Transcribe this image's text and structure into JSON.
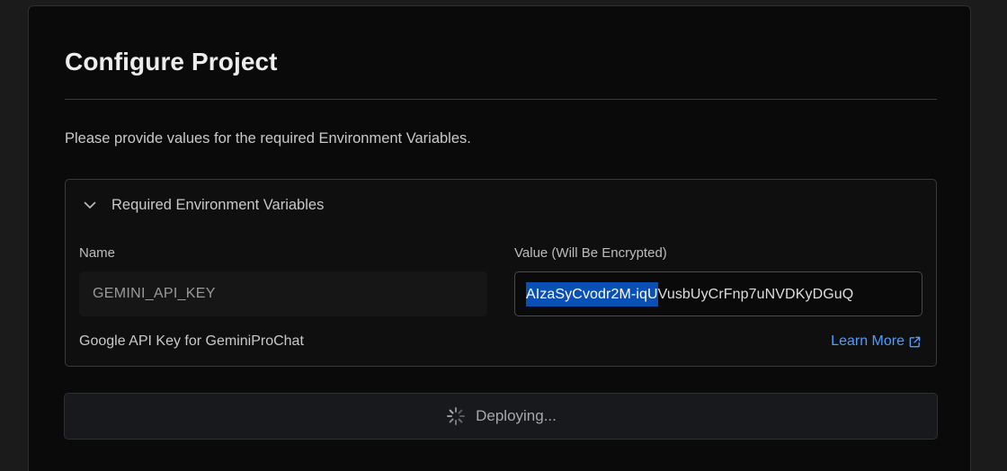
{
  "page": {
    "title": "Configure Project",
    "description": "Please provide values for the required Environment Variables."
  },
  "env_panel": {
    "header": "Required Environment Variables",
    "name_label": "Name",
    "value_label": "Value (Will Be Encrypted)",
    "name_value": "GEMINI_API_KEY",
    "value_selected": "AIzaSyCvodr2M-iqU",
    "value_rest": "VusbUyCrFnp7uNVDKyDGuQ",
    "help_text": "Google API Key for GeminiProChat",
    "learn_more": "Learn More"
  },
  "deploy": {
    "label": "Deploying..."
  },
  "colors": {
    "accent_link": "#4e9dff",
    "selection": "#0a4fb3",
    "background": "#0a0a0a"
  },
  "icons": {
    "panel_toggle": "chevron-down-icon",
    "learn_more": "external-link-icon",
    "deploy_status": "spinner-icon"
  }
}
